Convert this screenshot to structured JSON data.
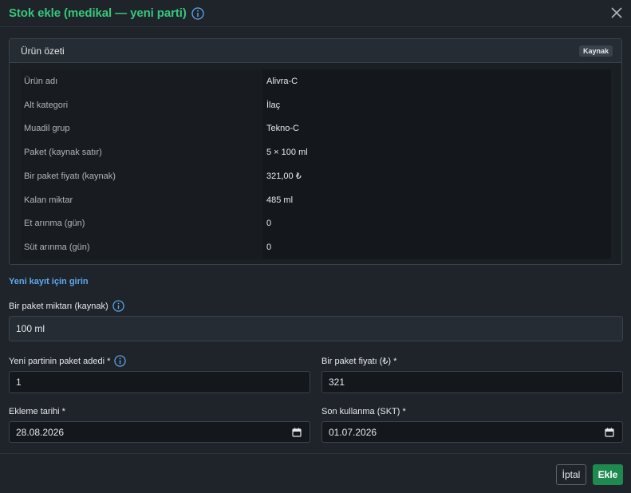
{
  "dialog": {
    "title": "Stok ekle (medikal — yeni parti)"
  },
  "summary": {
    "title": "Ürün özeti",
    "badge": "Kaynak",
    "rows": [
      {
        "label": "Ürün adı",
        "value": "Alivra-C"
      },
      {
        "label": "Alt kategori",
        "value": "İlaç"
      },
      {
        "label": "Muadil grup",
        "value": "Tekno-C"
      },
      {
        "label": "Paket (kaynak satır)",
        "value": "5 × 100 ml"
      },
      {
        "label": "Bir paket fiyatı (kaynak)",
        "value": "321,00 ₺"
      },
      {
        "label": "Kalan miktar",
        "value": "485 ml"
      },
      {
        "label": "Et arınma (gün)",
        "value": "0"
      },
      {
        "label": "Süt arınma (gün)",
        "value": "0"
      }
    ]
  },
  "form": {
    "section_title": "Yeni kayıt için girin",
    "package_amount": {
      "label": "Bir paket miktarı (kaynak)",
      "value": "100 ml"
    },
    "package_count": {
      "label": "Yeni partinin paket adedi *",
      "value": "1"
    },
    "package_price": {
      "label": "Bir paket fiyatı (₺) *",
      "value": "321"
    },
    "added_date": {
      "label": "Ekleme tarihi *",
      "value": "28.08.2026"
    },
    "expiry_date": {
      "label": "Son kullanma (SKT) *",
      "value": "01.07.2026"
    }
  },
  "footer": {
    "cancel_label": "İptal",
    "ok_label": "Ekle"
  },
  "colors": {
    "accent": "#37c77a",
    "info": "#5ea8f0",
    "primary_button": "#1f8a50"
  },
  "icons": [
    "info-icon",
    "close-icon",
    "calendar-icon"
  ]
}
